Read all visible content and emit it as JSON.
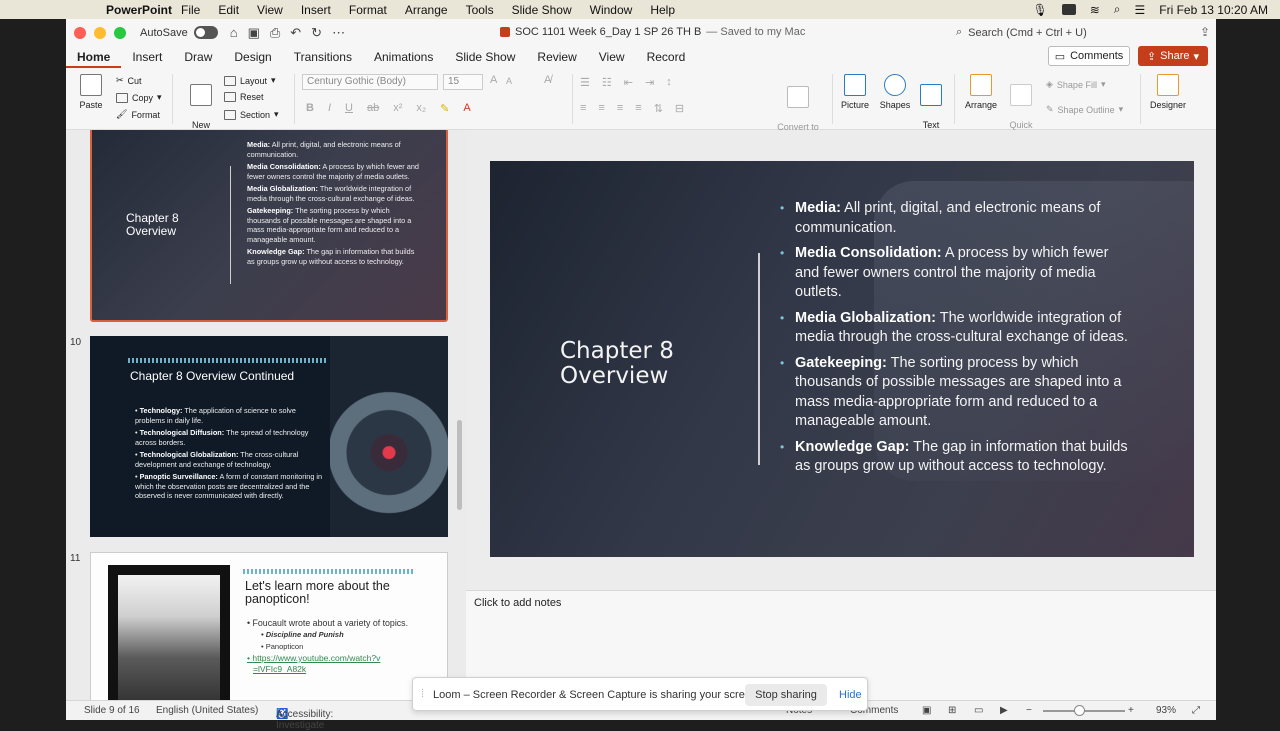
{
  "menubar": {
    "app_name": "PowerPoint",
    "items": [
      "File",
      "Edit",
      "View",
      "Insert",
      "Format",
      "Arrange",
      "Tools",
      "Slide Show",
      "Window",
      "Help"
    ],
    "clock": "Fri Feb 13  10:20 AM"
  },
  "titlebar": {
    "autosave_label": "AutoSave",
    "doc_name": "SOC 1101 Week 6_Day 1 SP 26 TH B",
    "saved_status": "— Saved to my Mac",
    "search_placeholder": "Search (Cmd + Ctrl + U)"
  },
  "tabs": [
    "Home",
    "Insert",
    "Draw",
    "Design",
    "Transitions",
    "Animations",
    "Slide Show",
    "Review",
    "View",
    "Record"
  ],
  "tab_active": "Home",
  "buttons": {
    "comments": "Comments",
    "share": "Share"
  },
  "ribbon": {
    "paste": "Paste",
    "cut": "Cut",
    "copy": "Copy",
    "format": "Format",
    "new_slide": "New\nSlide",
    "layout": "Layout",
    "reset": "Reset",
    "section": "Section",
    "font_name": "Century Gothic (Body)",
    "font_size": "15",
    "convert_smartart": "Convert to\nSmartArt",
    "picture": "Picture",
    "shapes": "Shapes",
    "text_box": "Text\nBox",
    "arrange": "Arrange",
    "quick_styles": "Quick\nStyles",
    "shape_fill": "Shape Fill",
    "shape_outline": "Shape Outline",
    "designer": "Designer"
  },
  "thumbnails": {
    "slide9": {
      "title": "Chapter 8\nOverview",
      "items": [
        {
          "term": "Media:",
          "text": " All print, digital, and electronic means of communication."
        },
        {
          "term": "Media Consolidation:",
          "text": " A process by which fewer and fewer owners control the majority of media outlets."
        },
        {
          "term": "Media Globalization:",
          "text": " The worldwide integration of media through the cross-cultural exchange of ideas."
        },
        {
          "term": "Gatekeeping:",
          "text": " The sorting process by which thousands of possible messages are shaped into a mass media-appropriate form and reduced to a manageable amount."
        },
        {
          "term": "Knowledge Gap:",
          "text": " The gap in information that builds as groups grow up without access to technology."
        }
      ]
    },
    "slide10": {
      "number": "10",
      "title": "Chapter 8 Overview Continued",
      "items": [
        {
          "term": "Technology:",
          "text": " The application of science to solve problems in daily life."
        },
        {
          "term": "Technological Diffusion:",
          "text": " The spread of technology across borders."
        },
        {
          "term": "Technological Globalization:",
          "text": " The cross-cultural development and exchange of technology."
        },
        {
          "term": "Panoptic Surveillance:",
          "text": " A form of constant monitoring in which the observation posts are decentralized and the observed is never communicated with directly."
        }
      ]
    },
    "slide11": {
      "number": "11",
      "title": "Let's learn more about the panopticon!",
      "bullet1": "Foucault wrote about a variety of topics.",
      "sub1": "Discipline and Punish",
      "sub2": "Panopticon",
      "link": "https://www.youtube.com/watch?v=lVFIc9_A82k",
      "link_line1": "https://www.youtube.com/watch?v",
      "link_line2": "=lVFIc9_A82k"
    }
  },
  "slide": {
    "title": "Chapter 8\nOverview",
    "items": [
      {
        "term": "Media:",
        "text": " All print, digital, and electronic means of communication."
      },
      {
        "term": "Media Consolidation:",
        "text": " A process by which fewer and fewer owners control the majority of media outlets."
      },
      {
        "term": "Media Globalization:",
        "text": " The worldwide integration of media through the cross-cultural exchange of ideas."
      },
      {
        "term": "Gatekeeping:",
        "text": " The sorting process by which thousands of possible messages are shaped into a mass media-appropriate form and reduced to a manageable amount."
      },
      {
        "term": "Knowledge Gap:",
        "text": " The gap in information that builds as groups grow up without access to technology."
      }
    ]
  },
  "notes_placeholder": "Click to add notes",
  "status": {
    "slide_of": "Slide 9 of 16",
    "language": "English (United States)",
    "accessibility": "Accessibility: Investigate",
    "notes": "Notes",
    "comments": "Comments",
    "zoom": "93%",
    "zoom_level": 0.44
  },
  "loom": {
    "message": "Loom – Screen Recorder & Screen Capture is sharing your screen.",
    "stop": "Stop sharing",
    "hide": "Hide"
  }
}
